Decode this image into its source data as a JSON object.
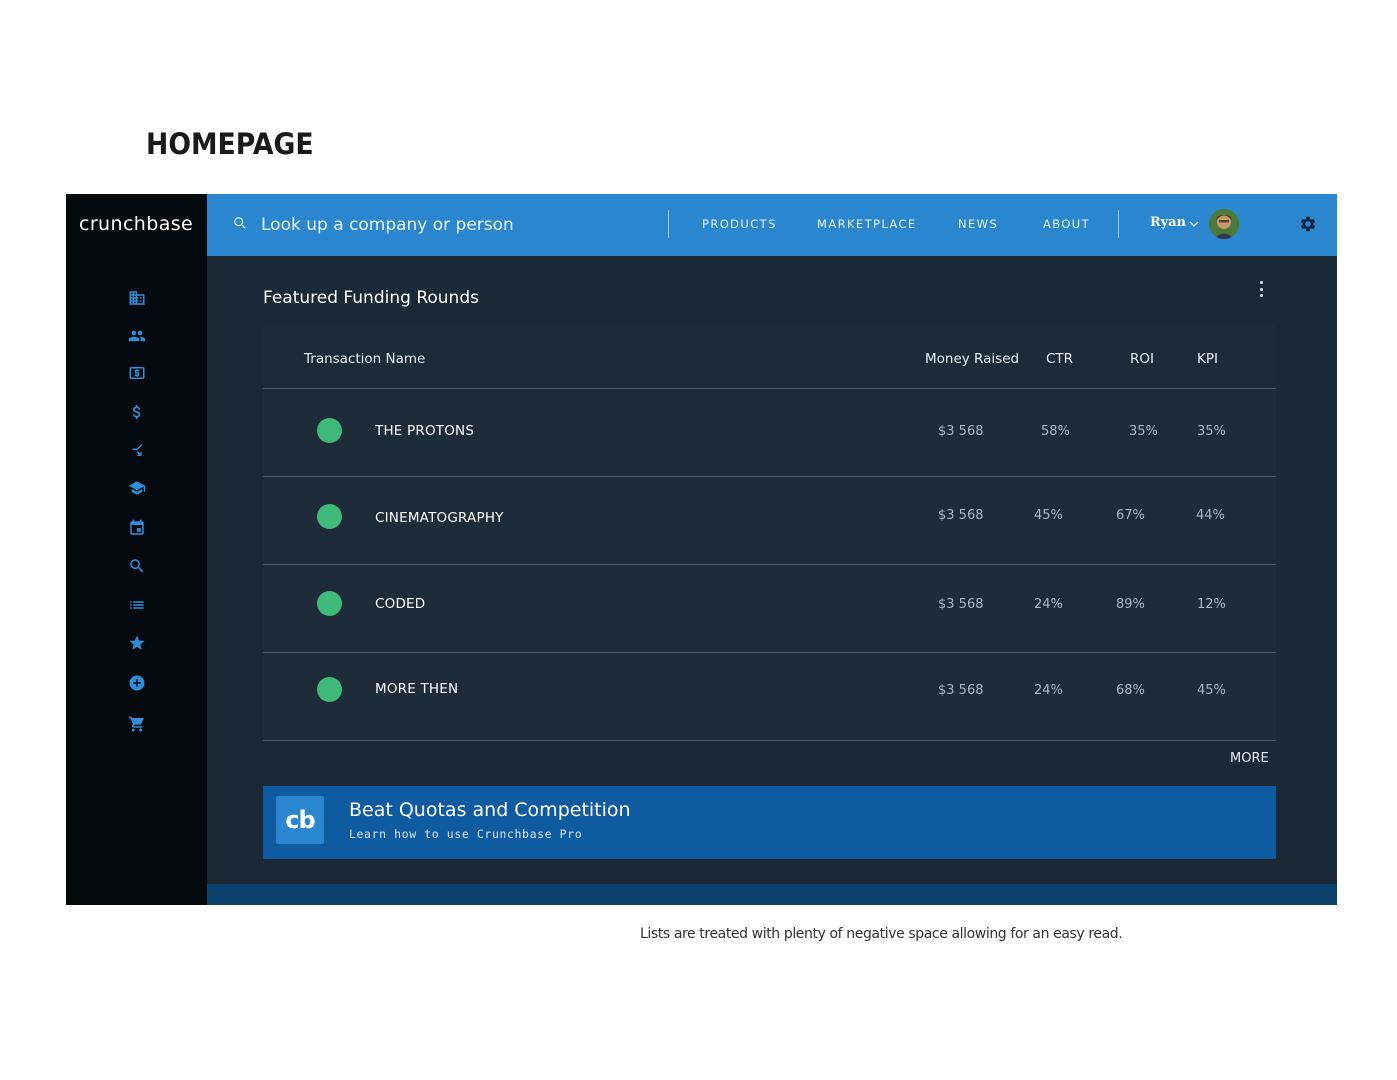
{
  "page": {
    "heading": "HOMEPAGE",
    "caption": "Lists are treated with plenty of negative space allowing for an easy read."
  },
  "app": {
    "logo": "crunchbase",
    "sidebar_icons": [
      "companies-icon",
      "people-icon",
      "funding-rounds-icon",
      "dollar-icon",
      "acquisitions-icon",
      "schools-icon",
      "events-icon",
      "search-icon",
      "lists-icon",
      "favorites-icon",
      "add-icon",
      "cart-icon"
    ],
    "search": {
      "placeholder": "Look up a company or person"
    },
    "nav": [
      "PRODUCTS",
      "MARKETPLACE",
      "NEWS",
      "ABOUT"
    ],
    "user": {
      "name": "Ryan"
    },
    "colors": {
      "topbar": "#2a87cf",
      "sidebar": "#050a0e",
      "content": "#1b2836",
      "status_dot": "#3fba7a",
      "promo": "#0f5ba1"
    }
  },
  "card": {
    "title": "Featured Funding Rounds",
    "columns": [
      "Transaction Name",
      "Money Raised",
      "CTR",
      "ROI",
      "KPI"
    ],
    "rows": [
      {
        "name": "THE PROTONS",
        "money": "$3 568",
        "ctr": "58%",
        "roi": "35%",
        "kpi": "35%"
      },
      {
        "name": "CINEMATOGRAPHY",
        "money": "$3 568",
        "ctr": "45%",
        "roi": "67%",
        "kpi": "44%"
      },
      {
        "name": "CODED",
        "money": "$3 568",
        "ctr": "24%",
        "roi": "89%",
        "kpi": "12%"
      },
      {
        "name": "MORE THEN",
        "money": "$3 568",
        "ctr": "24%",
        "roi": "68%",
        "kpi": "45%"
      }
    ],
    "more_label": "MORE"
  },
  "promo": {
    "logo_text": "cb",
    "title": "Beat Quotas and Competition",
    "subtitle": "Learn how to use Crunchbase Pro"
  }
}
